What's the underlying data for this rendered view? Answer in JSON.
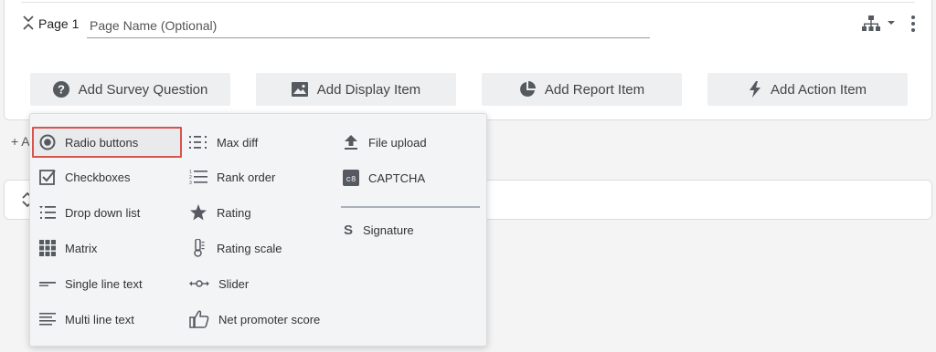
{
  "page": {
    "label": "Page 1",
    "name_placeholder": "Page Name (Optional)"
  },
  "add_buttons": [
    {
      "label": "Add Survey Question",
      "icon": "question-circle-icon"
    },
    {
      "label": "Add Display Item",
      "icon": "image-icon"
    },
    {
      "label": "Add Report Item",
      "icon": "pie-chart-icon"
    },
    {
      "label": "Add Action Item",
      "icon": "lightning-icon"
    }
  ],
  "add_page_link": "+ A",
  "question_menu": {
    "column1": [
      {
        "label": "Radio buttons",
        "icon": "radio-button-icon",
        "selected": true
      },
      {
        "label": "Checkboxes",
        "icon": "checkbox-icon"
      },
      {
        "label": "Drop down list",
        "icon": "dropdown-list-icon"
      },
      {
        "label": "Matrix",
        "icon": "matrix-grid-icon"
      },
      {
        "label": "Single line text",
        "icon": "single-line-text-icon"
      },
      {
        "label": "Multi line text",
        "icon": "multi-line-text-icon"
      }
    ],
    "column2": [
      {
        "label": "Max diff",
        "icon": "max-diff-icon"
      },
      {
        "label": "Rank order",
        "icon": "rank-order-icon"
      },
      {
        "label": "Rating",
        "icon": "star-icon"
      },
      {
        "label": "Rating scale",
        "icon": "thermometer-icon"
      },
      {
        "label": "Slider",
        "icon": "slider-icon"
      },
      {
        "label": "Net promoter score",
        "icon": "thumbs-up-icon"
      }
    ],
    "column3": [
      {
        "label": "File upload",
        "icon": "upload-icon"
      },
      {
        "label": "CAPTCHA",
        "icon": "captcha-icon"
      },
      {
        "label": "Signature",
        "icon": "signature-icon"
      }
    ]
  },
  "colors": {
    "selected_border": "#d9534f",
    "icon_gray": "#555a61"
  }
}
